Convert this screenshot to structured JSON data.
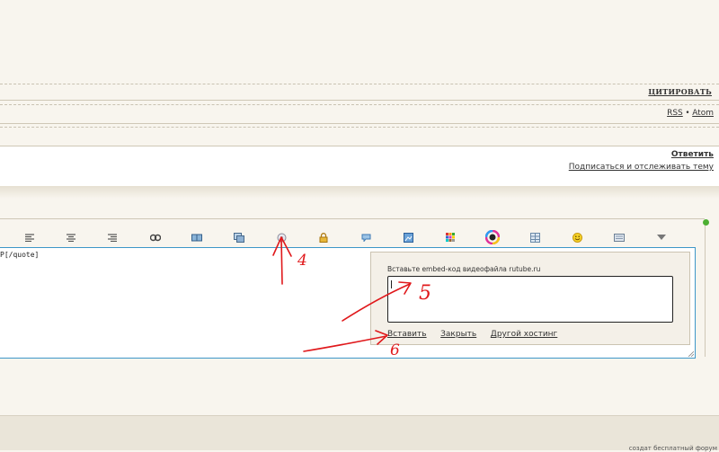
{
  "post_actions": {
    "quote_label": "ЦИТИРОВАТЬ"
  },
  "feeds": {
    "rss": "RSS",
    "separator": "•",
    "atom": "Atom"
  },
  "reply": {
    "reply_label": "Ответить",
    "subscribe_label": "Подписаться и отслеживать тему"
  },
  "toolbar": {
    "icons": [
      "align-left-icon",
      "align-center-icon",
      "align-right-icon",
      "link-icon",
      "book-icon",
      "images-icon",
      "video-icon",
      "lock-icon",
      "comment-icon",
      "image-icon",
      "palette-icon",
      "color-wheel-icon",
      "table-icon",
      "smiley-icon",
      "keyboard-icon",
      "dropdown-arrow-icon"
    ]
  },
  "editor": {
    "content": "P[/quote]"
  },
  "video_popup": {
    "label": "Вставьте embed-код видеофайла rutube.ru",
    "textarea_value": "",
    "insert_label": "Вставить",
    "close_label": "Закрыть",
    "other_hosting_label": "Другой хостинг"
  },
  "annotations": {
    "n4": "4",
    "n5": "5",
    "n6": "6",
    "color": "#e0181b"
  },
  "footer": {
    "text": "создат бесплатный форум"
  }
}
